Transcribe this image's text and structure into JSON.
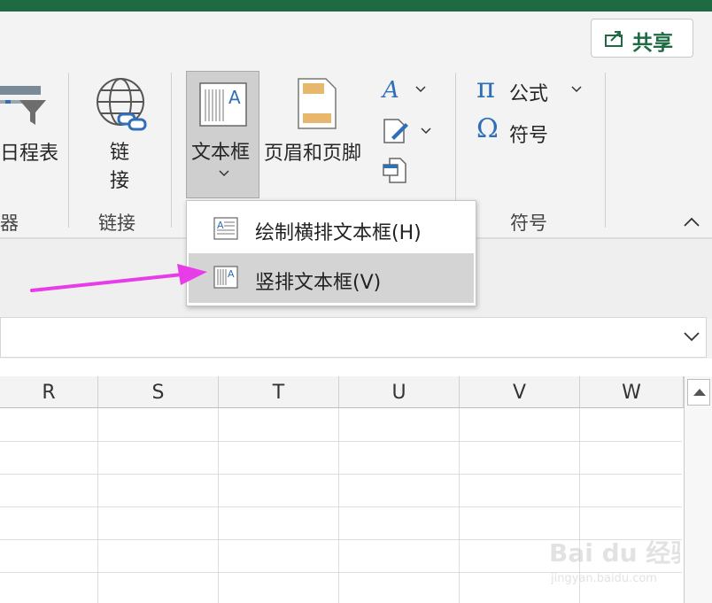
{
  "share": {
    "label": "共享"
  },
  "ribbon": {
    "partial_left_label": "日程表",
    "partial_group_label": "器",
    "link": {
      "label_line1": "链",
      "label_line2": "接",
      "group": "链接"
    },
    "textbox": {
      "label": "文本框",
      "chevron": "⌄"
    },
    "header_footer": {
      "label": "页眉和页脚"
    },
    "symbols": {
      "equation_label": "公式",
      "symbol_label": "符号",
      "group": "符号",
      "pi": "π",
      "omega": "Ω"
    },
    "collapse_glyph": "^"
  },
  "dropdown": {
    "items": [
      {
        "label": "绘制横排文本框(H)"
      },
      {
        "label": "竖排文本框(V)",
        "highlighted": true
      }
    ]
  },
  "columns": [
    "R",
    "S",
    "T",
    "U",
    "V",
    "W"
  ],
  "annotation": {
    "arrow_color": "#e83ce8"
  },
  "watermark": {
    "brand": "Bai du 经验",
    "url": "jingyan.baidu.com"
  },
  "colors": {
    "excel_green": "#1e6b43",
    "selected_button": "#cfcfcf",
    "hover_item": "#d4d4d4"
  }
}
